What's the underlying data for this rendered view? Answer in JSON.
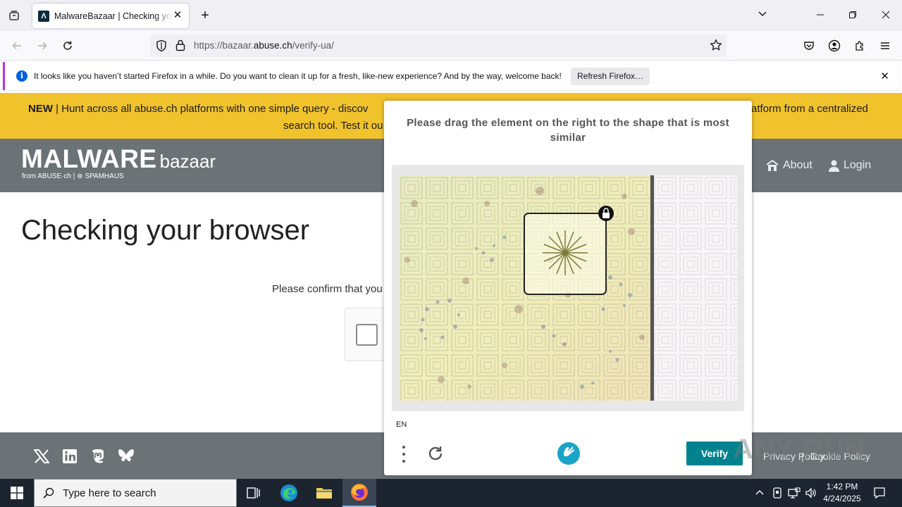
{
  "browser": {
    "tab_title": "MalwareBazaar | Checking your browser",
    "tab_favicon": "Λ",
    "new_tab_symbol": "+",
    "tab_close_symbol": "✕",
    "url_prefix": "https://bazaar.",
    "url_domain": "abuse.ch",
    "url_path": "/verify-ua/",
    "notification_text": "It looks like you haven’t started Firefox in a while. Do you want to clean it up for a fresh, like-new experience? And by the way, welcome back!",
    "notification_button": "Refresh Firefox…",
    "notification_icon_glyph": "i"
  },
  "banner": {
    "badge": "NEW",
    "line1_left": "| Hunt across all abuse.ch platforms with one simple query - discov",
    "line1_right": "atform from a centralized",
    "line2": "search tool. Test it ou"
  },
  "site": {
    "logo_main": "MALWARE",
    "logo_sub": "bazaar",
    "logo_from": "from ABUSE·ch  |  ⊛ SPAMHAUS",
    "nav_about": "About",
    "nav_login": "Login",
    "page_title": "Checking your browser",
    "confirm_text": "Please confirm that you are human",
    "footer_privacy": "Privacy Policy",
    "footer_separator": "|",
    "footer_cookie": "Cookie Policy"
  },
  "captcha": {
    "prompt": "Please drag the element on the right to the shape that is most similar",
    "language": "EN",
    "verify_label": "Verify"
  },
  "watermark": "ANY  RUN",
  "taskbar": {
    "search_placeholder": "Type here to search",
    "time": "1:42 PM",
    "date": "4/24/2025"
  },
  "colors": {
    "banner": "#f0c22c",
    "header": "#6c7377",
    "verify_button": "#00838f",
    "notification_accent": "#b833e1"
  },
  "icons": [
    "tab-list-icon",
    "back-icon",
    "forward-icon",
    "reload-icon",
    "shield-icon",
    "lock-icon",
    "star-icon",
    "pocket-icon",
    "account-icon",
    "extensions-icon",
    "hamburger-menu-icon",
    "info-icon",
    "home-icon",
    "user-icon",
    "x-twitter-icon",
    "linkedin-icon",
    "mastodon-icon",
    "bluesky-icon",
    "refresh-icon",
    "windows-start-icon",
    "search-icon",
    "task-view-icon",
    "edge-icon",
    "file-explorer-icon",
    "firefox-icon"
  ]
}
